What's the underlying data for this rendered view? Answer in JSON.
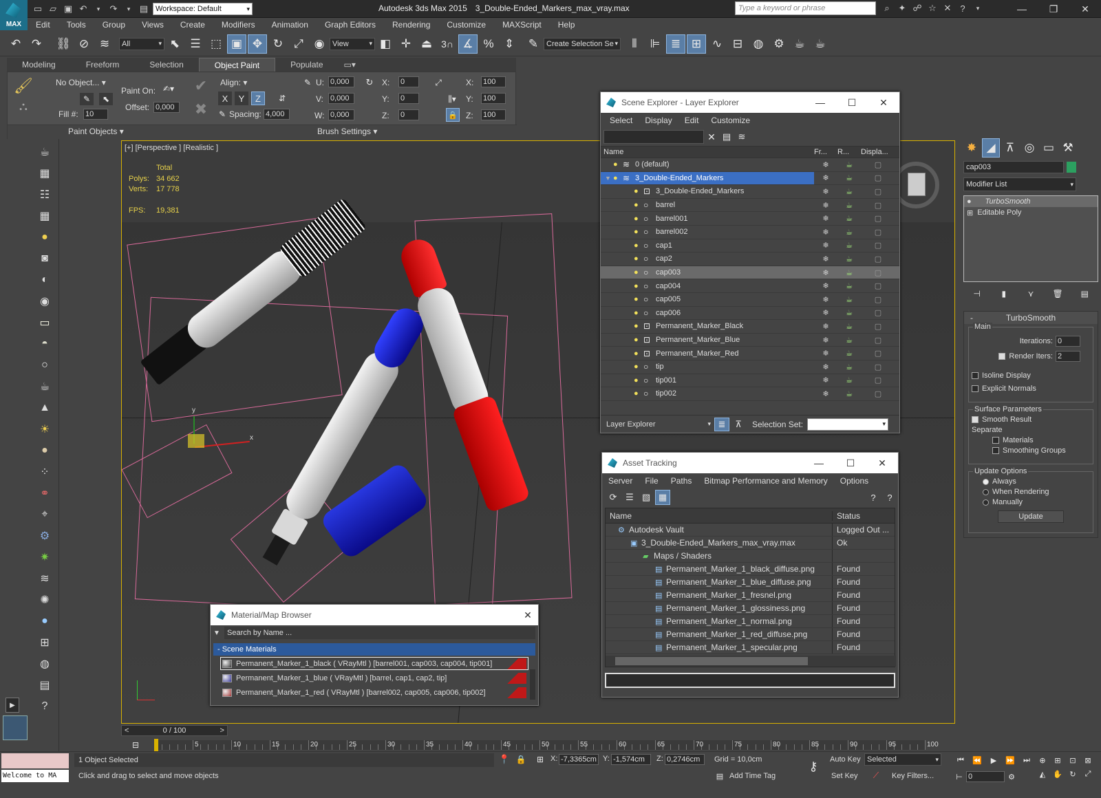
{
  "title_bar": {
    "app_title": "Autodesk 3ds Max  2015",
    "file_title": "3_Double-Ended_Markers_max_vray.max",
    "workspace": "Workspace: Default",
    "search_placeholder": "Type a keyword or phrase",
    "logo_text": "MAX"
  },
  "menu": [
    "Edit",
    "Tools",
    "Group",
    "Views",
    "Create",
    "Modifiers",
    "Animation",
    "Graph Editors",
    "Rendering",
    "Customize",
    "MAXScript",
    "Help"
  ],
  "toolbar": {
    "selection_filter": "All",
    "ref_coord": "View",
    "snap_label": "3",
    "named_selection": "Create Selection Se"
  },
  "ribbon": {
    "tabs": [
      "Modeling",
      "Freeform",
      "Selection",
      "Object Paint",
      "Populate"
    ],
    "active_tab": "Object Paint",
    "no_object": "No Object...",
    "paint_on": "Paint On:",
    "offset": "Offset:",
    "offset_val": "0,000",
    "fill": "Fill #:",
    "fill_val": "10",
    "align": "Align:",
    "axis_x": "X",
    "axis_y": "Y",
    "axis_z": "Z",
    "spacing": "Spacing:",
    "spacing_val": "4,000",
    "u": "U:",
    "v": "V:",
    "w": "W:",
    "uvw_val": "0,000",
    "x": "X:",
    "y": "Y:",
    "z": "Z:",
    "rot_val": "0",
    "scale_val": "100",
    "group_paint": "Paint Objects",
    "group_brush": "Brush Settings"
  },
  "viewport": {
    "label": "[+] [Perspective ] [Realistic ]",
    "stats_header": "Total",
    "polys_label": "Polys:",
    "polys": "34 662",
    "verts_label": "Verts:",
    "verts": "17 778",
    "fps_label": "FPS:",
    "fps": "19,381",
    "gizmo_x": "x",
    "gizmo_y": "y"
  },
  "scene_explorer": {
    "title": "Scene Explorer - Layer Explorer",
    "menu": [
      "Select",
      "Display",
      "Edit",
      "Customize"
    ],
    "cols": [
      "Name",
      "Fr...",
      "R...",
      "Displa..."
    ],
    "rows": [
      {
        "name": "0 (default)",
        "indent": 0,
        "type": "layer"
      },
      {
        "name": "3_Double-Ended_Markers",
        "indent": 0,
        "type": "layer",
        "selected": true
      },
      {
        "name": "3_Double-Ended_Markers",
        "indent": 1,
        "type": "group"
      },
      {
        "name": "barrel",
        "indent": 1,
        "type": "obj"
      },
      {
        "name": "barrel001",
        "indent": 1,
        "type": "obj"
      },
      {
        "name": "barrel002",
        "indent": 1,
        "type": "obj"
      },
      {
        "name": "cap1",
        "indent": 1,
        "type": "obj"
      },
      {
        "name": "cap2",
        "indent": 1,
        "type": "obj"
      },
      {
        "name": "cap003",
        "indent": 1,
        "type": "obj",
        "highlight": true
      },
      {
        "name": "cap004",
        "indent": 1,
        "type": "obj"
      },
      {
        "name": "cap005",
        "indent": 1,
        "type": "obj"
      },
      {
        "name": "cap006",
        "indent": 1,
        "type": "obj"
      },
      {
        "name": "Permanent_Marker_Black",
        "indent": 1,
        "type": "group"
      },
      {
        "name": "Permanent_Marker_Blue",
        "indent": 1,
        "type": "group"
      },
      {
        "name": "Permanent_Marker_Red",
        "indent": 1,
        "type": "group"
      },
      {
        "name": "tip",
        "indent": 1,
        "type": "obj"
      },
      {
        "name": "tip001",
        "indent": 1,
        "type": "obj"
      },
      {
        "name": "tip002",
        "indent": 1,
        "type": "obj"
      }
    ],
    "footer_mode": "Layer Explorer",
    "selection_set": "Selection Set:"
  },
  "asset_tracking": {
    "title": "Asset Tracking",
    "menu": [
      "Server",
      "File",
      "Paths",
      "Bitmap Performance and Memory",
      "Options"
    ],
    "cols": [
      "Name",
      "Status"
    ],
    "rows": [
      {
        "name": "Autodesk Vault",
        "status": "Logged Out ...",
        "indent": 1
      },
      {
        "name": "3_Double-Ended_Markers_max_vray.max",
        "status": "Ok",
        "indent": 2
      },
      {
        "name": "Maps / Shaders",
        "status": "",
        "indent": 3
      },
      {
        "name": "Permanent_Marker_1_black_diffuse.png",
        "status": "Found",
        "indent": 4
      },
      {
        "name": "Permanent_Marker_1_blue_diffuse.png",
        "status": "Found",
        "indent": 4
      },
      {
        "name": "Permanent_Marker_1_fresnel.png",
        "status": "Found",
        "indent": 4
      },
      {
        "name": "Permanent_Marker_1_glossiness.png",
        "status": "Found",
        "indent": 4
      },
      {
        "name": "Permanent_Marker_1_normal.png",
        "status": "Found",
        "indent": 4
      },
      {
        "name": "Permanent_Marker_1_red_diffuse.png",
        "status": "Found",
        "indent": 4
      },
      {
        "name": "Permanent_Marker_1_specular.png",
        "status": "Found",
        "indent": 4
      }
    ]
  },
  "material_browser": {
    "title": "Material/Map Browser",
    "search_placeholder": "Search by Name ...",
    "section": "- Scene Materials",
    "rows": [
      {
        "text": "Permanent_Marker_1_black  ( VRayMtl ) [barrel001, cap003, cap004, tip001]",
        "swatch": "#3a3a3a"
      },
      {
        "text": "Permanent_Marker_1_blue  ( VRayMtl ) [barrel, cap1, cap2, tip]",
        "swatch": "#3a3a9a"
      },
      {
        "text": "Permanent_Marker_1_red  ( VRayMtl ) [barrel002, cap005, cap006, tip002]",
        "swatch": "#a33a3a"
      }
    ]
  },
  "command_panel": {
    "object_name": "cap003",
    "modifier_list": "Modifier List",
    "stack": [
      "TurboSmooth",
      "Editable Poly"
    ],
    "rollout": "TurboSmooth",
    "main": "Main",
    "iterations_label": "Iterations:",
    "iterations": "0",
    "render_iters_label": "Render Iters:",
    "render_iters": "2",
    "isoline": "Isoline Display",
    "explicit_normals": "Explicit Normals",
    "surface_params": "Surface Parameters",
    "smooth_result": "Smooth Result",
    "separate": "Separate",
    "materials": "Materials",
    "smoothing_groups": "Smoothing Groups",
    "update_options": "Update Options",
    "always": "Always",
    "when_rendering": "When Rendering",
    "manually": "Manually",
    "update_btn": "Update"
  },
  "timeline": {
    "frame": "0 / 100",
    "ticks": [
      "5",
      "10",
      "15",
      "20",
      "25",
      "30",
      "35",
      "40",
      "45",
      "50",
      "55",
      "60",
      "65",
      "70",
      "75",
      "80",
      "85",
      "90",
      "95",
      "100"
    ]
  },
  "status": {
    "script_text": "Welcome to MA",
    "selected": "1 Object Selected",
    "prompt": "Click and drag to select and move objects",
    "x_label": "X:",
    "x": "-7,3365cm",
    "y_label": "Y:",
    "y": "-1,574cm",
    "z_label": "Z:",
    "z": "0,2746cm",
    "grid": "Grid = 10,0cm",
    "add_time_tag": "Add Time Tag",
    "auto_key": "Auto Key",
    "selected_mode": "Selected",
    "set_key": "Set Key",
    "key_filters": "Key Filters...",
    "frame_val": "0"
  }
}
